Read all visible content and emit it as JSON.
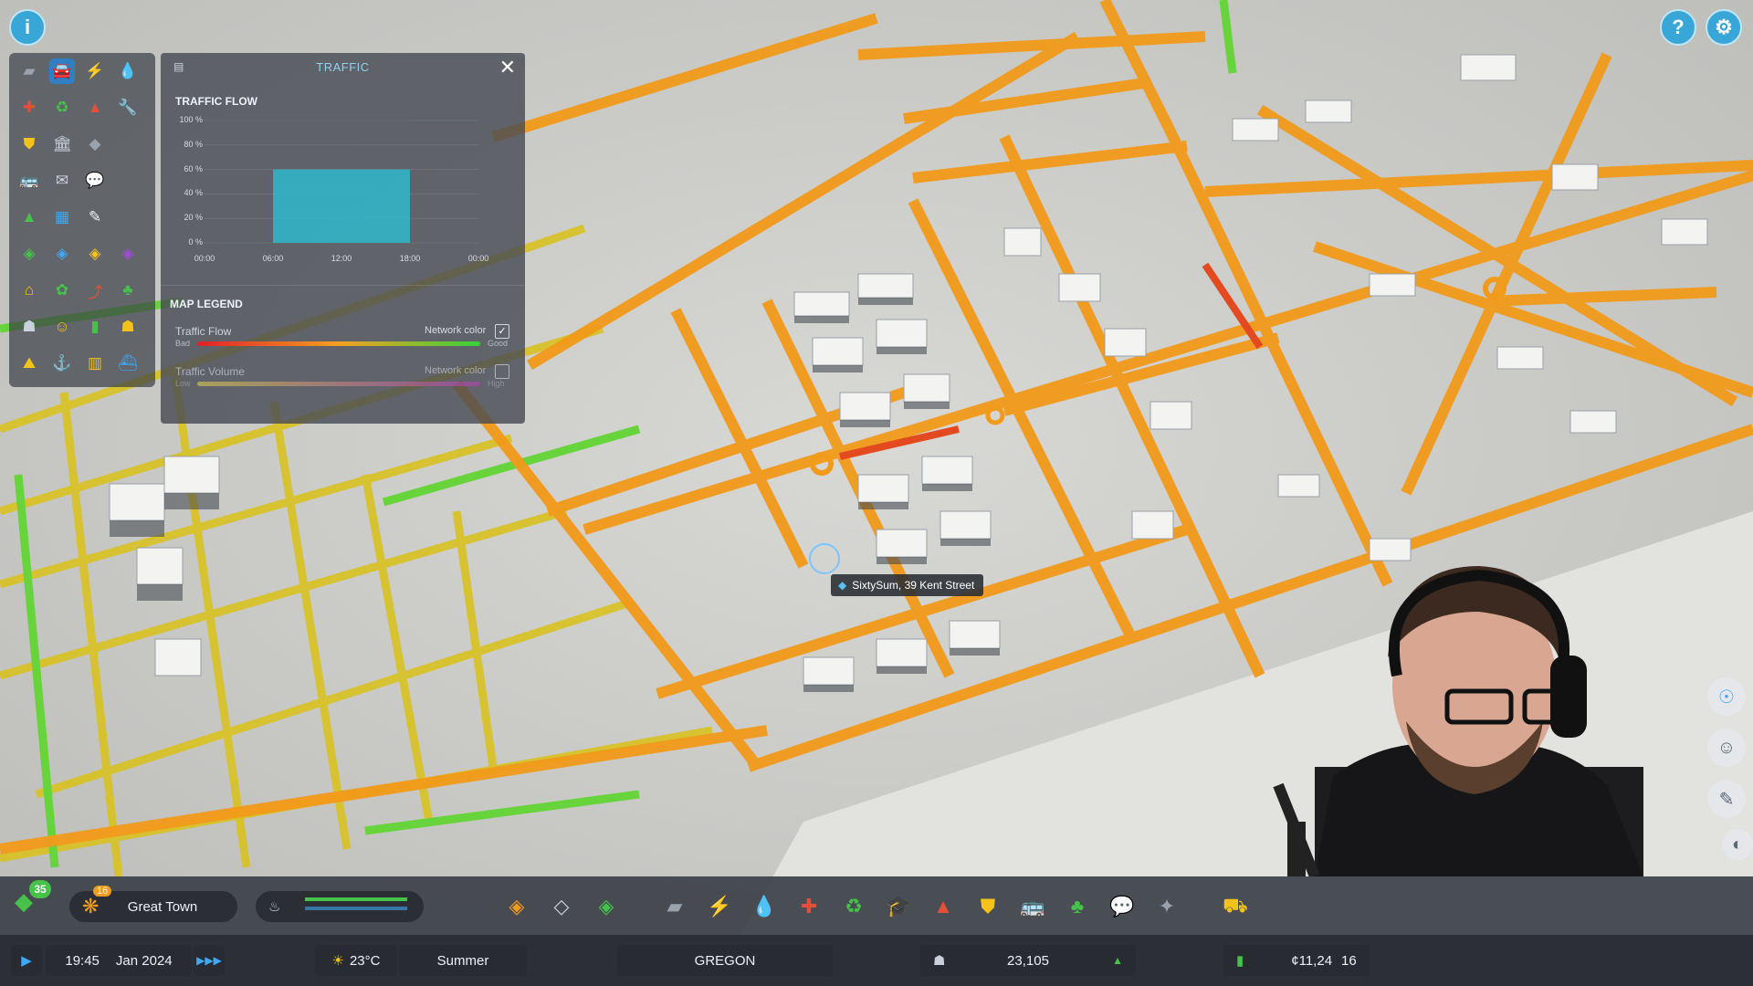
{
  "traffic_panel": {
    "title": "TRAFFIC",
    "flow_section": "TRAFFIC FLOW",
    "y_ticks": [
      "100 %",
      "80 %",
      "60 %",
      "40 %",
      "20 %",
      "0 %"
    ],
    "x_ticks": [
      "00:00",
      "06:00",
      "12:00",
      "18:00",
      "00:00"
    ],
    "legend_section": "MAP LEGEND",
    "legend": [
      {
        "label": "Traffic Flow",
        "network_color": "Network color",
        "checked": true,
        "low": "Bad",
        "high": "Good"
      },
      {
        "label": "Traffic Volume",
        "network_color": "Network color",
        "checked": false,
        "low": "Low",
        "high": "High"
      }
    ],
    "flow_color": "#2fb8cc"
  },
  "chart_data": {
    "type": "area",
    "x": [
      "06:00",
      "18:00"
    ],
    "values": [
      60,
      60
    ],
    "ylim": [
      0,
      100
    ],
    "x_ticks": [
      "00:00",
      "06:00",
      "12:00",
      "18:00",
      "00:00"
    ]
  },
  "tooltip": {
    "label": "SixtySum, 39 Kent Street",
    "icon": "location-icon"
  },
  "city": {
    "name": "Great Town",
    "level": "35",
    "milestone": "16"
  },
  "status": {
    "time": "19:45",
    "date": "Jan 2024",
    "temperature": "23°C",
    "season": "Summer",
    "region": "GREGON",
    "population": "23,105",
    "money": "¢11,24",
    "money_tail": "16"
  },
  "palette_icons": [
    "road-icon",
    "traffic-icon",
    "electricity-icon",
    "water-icon",
    "health-icon",
    "garbage-icon",
    "fire-icon",
    "wrench-icon",
    "police-icon",
    "education-icon",
    "landscape-icon",
    "",
    "transport-icon",
    "post-icon",
    "chat-icon",
    "",
    "forest-icon",
    "building-icon",
    "pencil-icon",
    "",
    "zone-residential-icon",
    "zone-commercial-icon",
    "zone-industrial-icon",
    "zone-office-icon",
    "home-icon",
    "park-icon",
    "signature-icon",
    "tree-icon",
    "person-icon",
    "happiness-icon",
    "money-icon",
    "tourism-icon",
    "terrain-icon",
    "harbor-icon",
    "train-icon",
    "ship-icon"
  ],
  "toolbar_icons": [
    "zoning-icon",
    "area-icon",
    "landscaping-icon",
    "road-tool-icon",
    "electricity-tool-icon",
    "water-tool-icon",
    "healthcare-tool-icon",
    "garbage-tool-icon",
    "education-tool-icon",
    "fire-tool-icon",
    "police-tool-icon",
    "transport-tool-icon",
    "parks-tool-icon",
    "communication-tool-icon",
    "landmark-tool-icon",
    "bulldozer-icon"
  ]
}
